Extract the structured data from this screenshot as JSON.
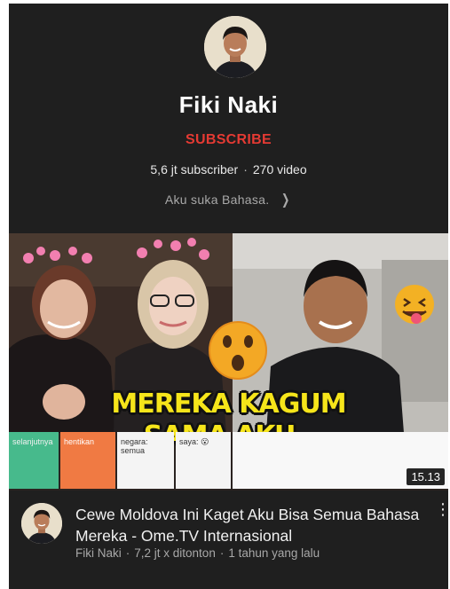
{
  "channel": {
    "name": "Fiki Naki",
    "subscribe_label": "SUBSCRIBE",
    "subscribers": "5,6 jt subscriber",
    "videos": "270 video",
    "separator": "·",
    "description": "Aku suka Bahasa.",
    "description_chevron": "❯"
  },
  "video": {
    "thumbnail": {
      "headline_line1": "MEREKA KAGUM",
      "headline_line2": "SAMA AKU..",
      "controls": {
        "next": "selanjutnya",
        "stop": "hentikan",
        "country": "negara: semua",
        "me": "saya: 😮"
      },
      "emoji_surprised": "😲",
      "emoji_tongue": "😝"
    },
    "duration": "15.13",
    "title": "Cewe Moldova Ini Kaget Aku Bisa Semua Bahasa Mereka - Ome.TV Internasional",
    "channel_name": "Fiki Naki",
    "views": "7,2 jt x ditonton",
    "age": "1 tahun yang lalu",
    "separator": "·",
    "menu_glyph": "⋮"
  },
  "colors": {
    "background": "#1f1f1f",
    "subscribe": "#e53a33",
    "headline": "#f6e51a",
    "next_button": "#47ba8c",
    "stop_button": "#f07a43"
  }
}
